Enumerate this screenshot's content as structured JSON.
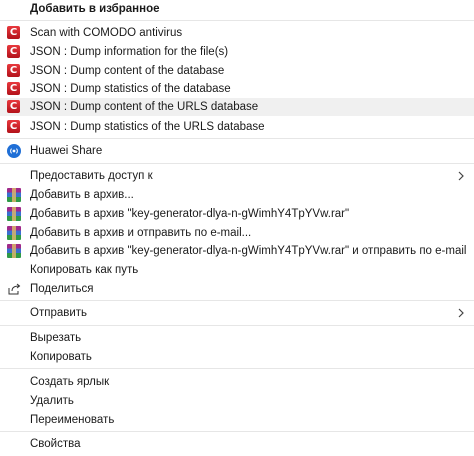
{
  "menu": {
    "favorites": "Добавить в избранное",
    "comodo_scan": "Scan with COMODO antivirus",
    "json_dump_info": "JSON : Dump information for the file(s)",
    "json_dump_db": "JSON : Dump content of the database",
    "json_dump_stats": "JSON : Dump statistics of the database",
    "json_dump_urls": "JSON : Dump content of the URLS database",
    "json_dump_urls_stats": "JSON : Dump statistics of the URLS database",
    "huawei_share": "Huawei Share",
    "grant_access": "Предоставить доступ к",
    "add_archive": "Добавить в архив...",
    "add_archive_named": "Добавить в архив \"key-generator-dlya-n-gWimhY4TpYVw.rar\"",
    "add_archive_email": "Добавить в архив и отправить по e-mail...",
    "add_archive_named_email": "Добавить в архив \"key-generator-dlya-n-gWimhY4TpYVw.rar\" и отправить по e-mail",
    "copy_path": "Копировать как путь",
    "share": "Поделиться",
    "send_to": "Отправить",
    "cut": "Вырезать",
    "copy": "Копировать",
    "create_shortcut": "Создать ярлык",
    "delete": "Удалить",
    "rename": "Переименовать",
    "properties": "Свойства"
  },
  "icons": {
    "comodo_letter": "C",
    "comodo": "comodo-icon",
    "huawei": "huawei-share-icon",
    "winrar": "winrar-icon",
    "share": "share-icon",
    "chevron": "chevron-right-icon"
  },
  "colors": {
    "highlight": "#f0f0f0",
    "comodo_red": "#d0202a",
    "huawei_blue": "#1f6fd6"
  }
}
